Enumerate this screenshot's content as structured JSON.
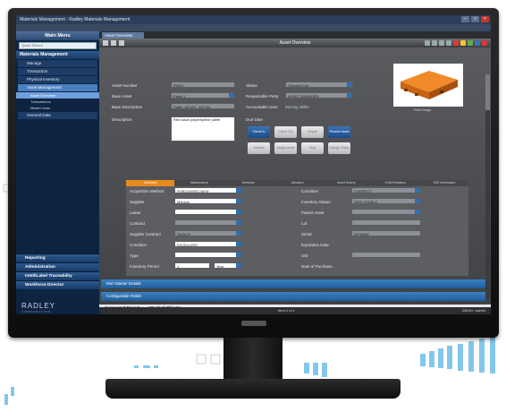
{
  "window": {
    "title": "Materials Management - Radley Materials Management",
    "minimize": "–",
    "maximize": "□",
    "close": "×"
  },
  "sidebar": {
    "header": "Main Menu",
    "search_placeholder": "Quick Search",
    "section": "Materials Management",
    "items": [
      {
        "label": "Manage"
      },
      {
        "label": "Transaction"
      },
      {
        "label": "Physical Inventory"
      },
      {
        "label": "Asset Management",
        "selected": true
      }
    ],
    "subitems": [
      {
        "label": "Asset Overview",
        "selected": true
      },
      {
        "label": "Transactions"
      },
      {
        "label": "Master Data"
      }
    ],
    "extra_item": "General Data",
    "bottom_sections": [
      "Reporting",
      "Administration",
      "IntelliLabel Traceability",
      "Workforce Director"
    ],
    "brand": "RADLEY",
    "brand_sub": "CORPORATION"
  },
  "main": {
    "tab_label": "Asset Overview",
    "toolbar_title": "Asset Overview",
    "pallet_caption": "Pallet Image",
    "fields_left": [
      {
        "label": "Asset Number",
        "value": "P9001"
      },
      {
        "label": "Base Asset",
        "value": "Pallet 1"
      },
      {
        "label": "Base Description",
        "value": "Pallet, 48\"x40\", 4W Wd"
      },
      {
        "label": "Description",
        "value": "Red stack polyethylene pallet"
      }
    ],
    "fields_mid": [
      {
        "label": "Status",
        "value": "Checked Out"
      },
      {
        "label": "Responsible Party",
        "value": "ASSET MANAGER"
      },
      {
        "label": "Accountable User",
        "value": "Murray, Willis"
      }
    ],
    "due_date_label": "Due Date",
    "tiles": [
      {
        "label": "Check In",
        "blue": true
      },
      {
        "label": "Check Out",
        "blue": false
      },
      {
        "label": "Repair",
        "blue": false
      },
      {
        "label": "Receive Asset",
        "blue": true
      },
      {
        "label": "Transfer",
        "blue": false
      },
      {
        "label": "Assign Asset",
        "blue": false
      },
      {
        "label": "Ship",
        "blue": false
      },
      {
        "label": "Change Status",
        "blue": false
      }
    ],
    "subtabs": [
      {
        "label": "Overview",
        "active": true
      },
      {
        "label": "Maintenance"
      },
      {
        "label": "Warranty"
      },
      {
        "label": "Valuation"
      },
      {
        "label": "Asset History"
      },
      {
        "label": "Child Relations"
      },
      {
        "label": "MIS Information"
      }
    ],
    "detail_left": [
      {
        "label": "Acquisition Method",
        "value": "PURCHASED NEW"
      },
      {
        "label": "Supplier",
        "value": "Manson"
      },
      {
        "label": "Lease",
        "value": ""
      },
      {
        "label": "Contract",
        "value": ""
      },
      {
        "label": "Supplier Contract",
        "value": "SUZ01S"
      },
      {
        "label": "Condition",
        "value": "EXCELLENT"
      },
      {
        "label": "Type",
        "value": ""
      },
      {
        "label": "Inventory Period",
        "value": "1"
      }
    ],
    "inventory_unit": "Year",
    "detail_right": [
      {
        "label": "Condition",
        "value": "CORRECT"
      },
      {
        "label": "Inventory Status",
        "value": "DEPLOYABLE"
      },
      {
        "label": "Parent Asset",
        "value": ""
      },
      {
        "label": "Lot",
        "value": ""
      },
      {
        "label": "Serial",
        "value": "SP33948"
      },
      {
        "label": "Expiration Date",
        "value": ""
      },
      {
        "label": "UID",
        "value": ""
      },
      {
        "label": "Date of Purchase",
        "value": ""
      }
    ],
    "collapsible": [
      "Item Master Details",
      "Configurable Fields"
    ],
    "footer_links": [
      "Connected Report",
      "Attached Objects"
    ],
    "status_center": "Item 1 of 1",
    "status_right": "DEMO / admin"
  },
  "colors": {
    "sidebar": "#0d2342",
    "accent": "#2f6fb3",
    "orange": "#e88a1e"
  }
}
